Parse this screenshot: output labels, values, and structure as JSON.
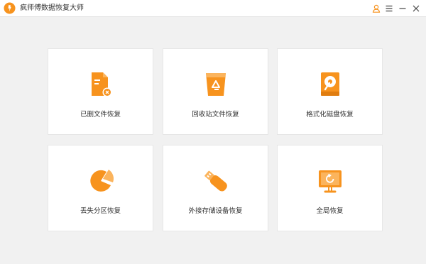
{
  "app": {
    "title": "疯师傅数据恢复大师",
    "logo_icon": "app-logo-icon",
    "accent_color": "#f7931e"
  },
  "titlebar": {
    "user_icon": "user-icon",
    "menu_icon": "menu-icon",
    "minimize_icon": "minimize-icon",
    "close_icon": "close-icon"
  },
  "cards": [
    {
      "label": "已删文件恢复",
      "icon": "deleted-file-icon"
    },
    {
      "label": "回收站文件恢复",
      "icon": "recycle-bin-icon"
    },
    {
      "label": "格式化磁盘恢复",
      "icon": "format-disk-icon"
    },
    {
      "label": "丢失分区恢复",
      "icon": "lost-partition-icon"
    },
    {
      "label": "外接存储设备恢复",
      "icon": "usb-drive-icon"
    },
    {
      "label": "全局恢复",
      "icon": "monitor-restore-icon"
    }
  ]
}
